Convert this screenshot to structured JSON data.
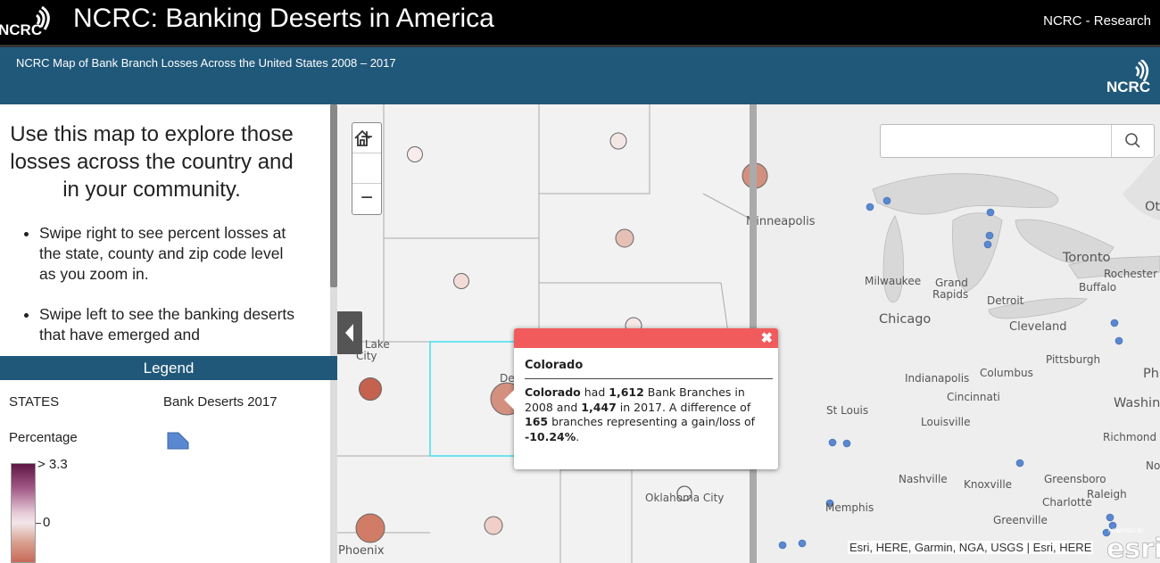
{
  "header": {
    "logo_text": "NCRC",
    "title": "NCRC: Banking Deserts in America",
    "link": "NCRC - Research"
  },
  "subheader": {
    "subtitle": "NCRC Map of Bank Branch Losses Across the United States 2008 – 2017",
    "logo_text": "NCRC"
  },
  "intro": {
    "heading": "Use this map to explore those losses across the country and in your community.",
    "bullets": [
      "Swipe right to see percent losses at the state, county and zip code level as you zoom in.",
      "Swipe left to see the banking deserts that have emerged and"
    ]
  },
  "legend": {
    "header": "Legend",
    "states_label": "STATES",
    "deserts_label": "Bank Deserts 2017",
    "percentage_label": "Percentage",
    "ramp_max": "> 3.3",
    "ramp_zero": "0",
    "desert_color": "#5a88d0"
  },
  "map": {
    "zoom_in": "+",
    "zoom_out": "−",
    "search_placeholder": "",
    "attribution": "Esri, HERE, Garmin, NGA, USGS | Esri, HERE",
    "esri_logo_text": "esri",
    "esri_powered": "POWERED BY",
    "city_labels": {
      "minneapolis": "Minneapolis",
      "toronto": "Toronto",
      "rochester": "Rochester",
      "buffalo": "Buffalo",
      "milwaukee": "Milwaukee",
      "grand_rapids_1": "Grand",
      "grand_rapids_2": "Rapids",
      "detroit": "Detroit",
      "chicago": "Chicago",
      "cleveland": "Cleveland",
      "pittsburgh": "Pittsburgh",
      "indianapolis": "Indianapolis",
      "columbus": "Columbus",
      "philadelphia": "Phi",
      "cincinnati": "Cincinnati",
      "st_louis": "St Louis",
      "washington": "Washingto",
      "louisville": "Louisville",
      "richmond": "Richmond",
      "norfolk": "Norf",
      "nashville": "Nashville",
      "knoxville": "Knoxville",
      "greensboro": "Greensboro",
      "charlotte": "Charlotte",
      "raleigh": "Raleigh",
      "oklahoma_city": "Oklahoma City",
      "memphis": "Memphis",
      "greenville": "Greenville",
      "phoenix": "Phoenix",
      "salt_lake_1": "Salt Lake",
      "salt_lake_2": "City",
      "ottawa": "Ot",
      "denver_partial": "De"
    }
  },
  "popup": {
    "title": "Colorado",
    "state": "Colorado",
    "t1": " had ",
    "branches_2008": "1,612",
    "t2": " Bank Branches in 2008 and ",
    "branches_2017": "1,447",
    "t3": " in 2017. A difference of ",
    "difference": "165",
    "t4": " branches representing a gain/loss of ",
    "percent": "-10.24%",
    "t5": ".",
    "close": "✖",
    "header_color": "#f15b5c"
  }
}
